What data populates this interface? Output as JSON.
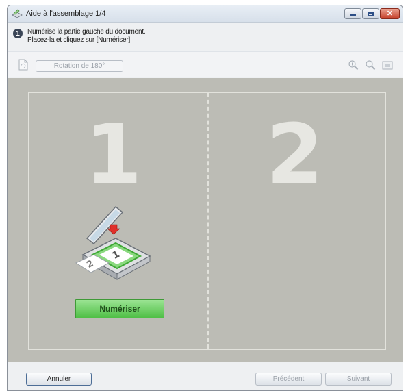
{
  "window": {
    "title": "Aide à l'assemblage 1/4",
    "close_glyph": "✕"
  },
  "instruction": {
    "line1": "Numérise la partie gauche du document.",
    "line2": "Placez-la et cliquez sur [Numériser].",
    "icon_glyph": "1"
  },
  "toolbar": {
    "rotate_label": "Rotation de 180°"
  },
  "pages": {
    "left_number": "1",
    "right_number": "2"
  },
  "scan": {
    "button_label": "Numériser"
  },
  "footer": {
    "cancel_label": "Annuler",
    "previous_label": "Précédent",
    "next_label": "Suivant"
  },
  "colors": {
    "scan_button": "#5cc952",
    "canvas_background": "#bcbcb5",
    "close_button": "#c6402a"
  },
  "icons": [
    "scanner-app-icon",
    "info-icon",
    "page-rotate-icon",
    "zoom-in-icon",
    "zoom-out-icon",
    "fit-page-icon",
    "scanner-icon"
  ]
}
